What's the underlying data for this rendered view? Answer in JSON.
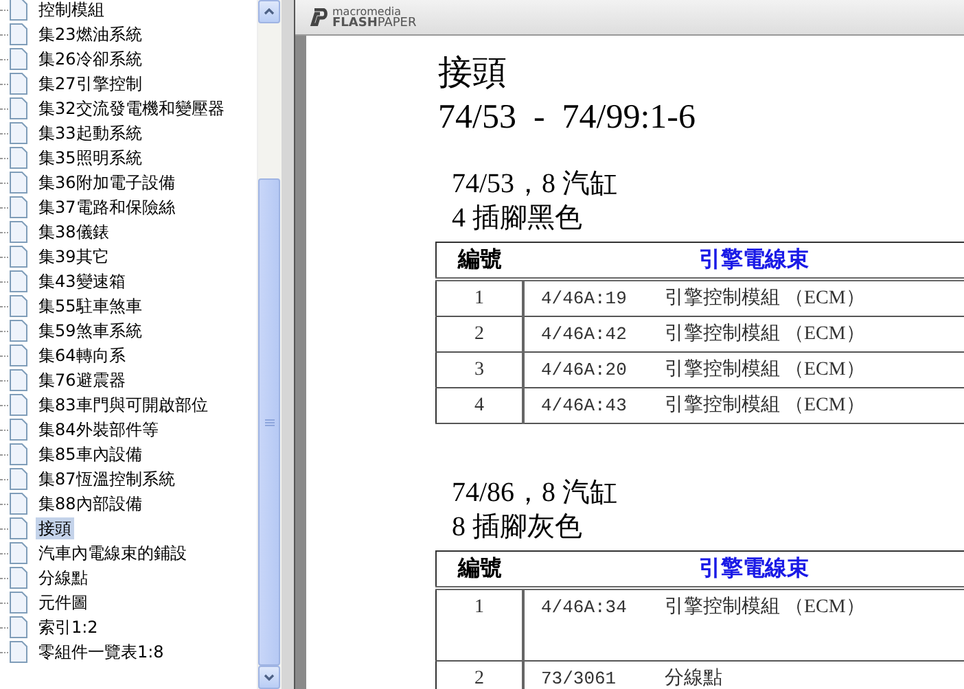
{
  "tree": {
    "items": [
      {
        "label": "控制模組",
        "selected": false
      },
      {
        "label": "集23燃油系統",
        "selected": false
      },
      {
        "label": "集26冷卻系統",
        "selected": false
      },
      {
        "label": "集27引擎控制",
        "selected": false
      },
      {
        "label": "集32交流發電機和變壓器",
        "selected": false
      },
      {
        "label": "集33起動系統",
        "selected": false
      },
      {
        "label": "集35照明系統",
        "selected": false
      },
      {
        "label": "集36附加電子設備",
        "selected": false
      },
      {
        "label": "集37電路和保險絲",
        "selected": false
      },
      {
        "label": "集38儀錶",
        "selected": false
      },
      {
        "label": "集39其它",
        "selected": false
      },
      {
        "label": "集43變速箱",
        "selected": false
      },
      {
        "label": "集55駐車煞車",
        "selected": false
      },
      {
        "label": "集59煞車系統",
        "selected": false
      },
      {
        "label": "集64轉向系",
        "selected": false
      },
      {
        "label": "集76避震器",
        "selected": false
      },
      {
        "label": "集83車門與可開啟部位",
        "selected": false
      },
      {
        "label": "集84外裝部件等",
        "selected": false
      },
      {
        "label": "集85車內設備",
        "selected": false
      },
      {
        "label": "集87恆溫控制系統",
        "selected": false
      },
      {
        "label": "集88內部設備",
        "selected": false
      },
      {
        "label": "接頭",
        "selected": true
      },
      {
        "label": "汽車內電線束的鋪設",
        "selected": false
      },
      {
        "label": "分線點",
        "selected": false
      },
      {
        "label": "元件圖",
        "selected": false
      },
      {
        "label": "索引1:2",
        "selected": false
      },
      {
        "label": "零組件一覽表1:8",
        "selected": false
      }
    ]
  },
  "viewer": {
    "logo": {
      "brand": "macromedia",
      "product": "**FLASH**PAPER"
    },
    "page": {
      "title": "接頭",
      "subtitle": "74/53  -  74/99:1-6",
      "sections": [
        {
          "heading": "74/53，8 汽缸",
          "subheading": "4 插腳黑色",
          "table": {
            "columns": [
              "編號",
              "引擎電線束"
            ],
            "rows": [
              {
                "cells": [
                  "1",
                  "4/46A:19",
                  "引擎控制模組 （ECM）"
                ]
              },
              {
                "cells": [
                  "2",
                  "4/46A:42",
                  "引擎控制模組 （ECM）"
                ]
              },
              {
                "cells": [
                  "3",
                  "4/46A:20",
                  "引擎控制模組 （ECM）"
                ]
              },
              {
                "cells": [
                  "4",
                  "4/46A:43",
                  "引擎控制模組 （ECM）"
                ]
              }
            ]
          }
        },
        {
          "heading": "74/86，8 汽缸",
          "subheading": "8 插腳灰色",
          "table": {
            "columns": [
              "編號",
              "引擎電線束"
            ],
            "rows": [
              {
                "cells": [
                  "1",
                  "4/46A:34",
                  "引擎控制模組 （ECM）"
                ],
                "tall": true
              },
              {
                "cells": [
                  "2",
                  "73/3061",
                  "分線點"
                ],
                "tall": false
              }
            ]
          }
        }
      ]
    }
  }
}
